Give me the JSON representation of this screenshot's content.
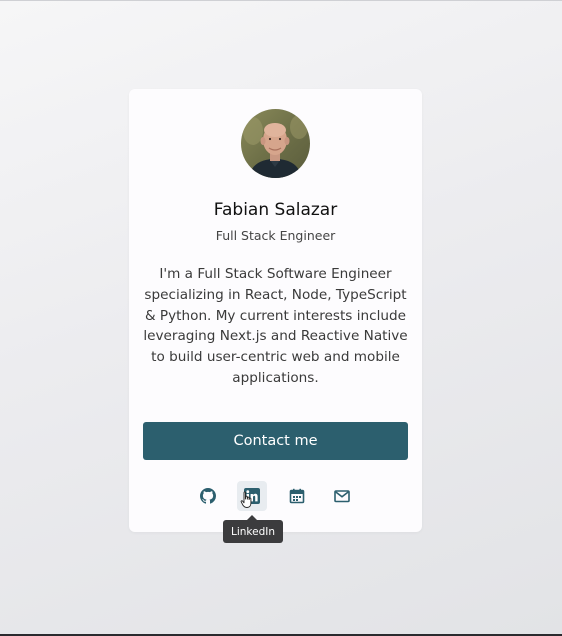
{
  "profile": {
    "name": "Fabian Salazar",
    "title": "Full Stack Engineer",
    "bio": "I'm a Full Stack Software Engineer specializing in React, Node, TypeScript & Python. My current interests include leveraging Next.js and Reactive Native to build user-centric web and mobile applications.",
    "contact_label": "Contact me"
  },
  "social": {
    "github_icon": "github-icon",
    "linkedin_icon": "linkedin-icon",
    "calendar_icon": "calendar-icon",
    "email_icon": "mail-icon",
    "hovered": "linkedin"
  },
  "tooltip": {
    "label": "LinkedIn"
  },
  "colors": {
    "accent": "#2c5f6e",
    "icon": "#2c5f6e",
    "tooltip_bg": "#3c3c3e",
    "card_bg": "#fdfcfe"
  }
}
